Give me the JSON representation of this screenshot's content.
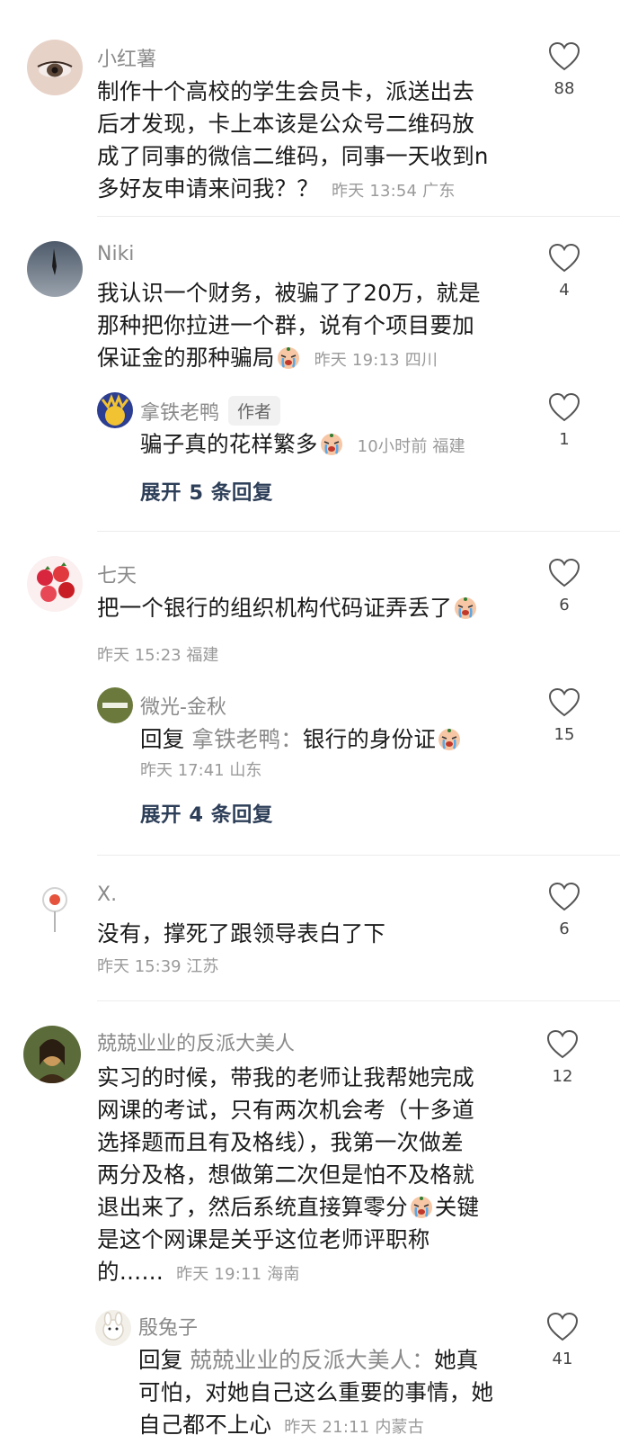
{
  "comments": [
    {
      "user": "小红薯",
      "lines": [
        "制作十个高校的学生会员卡，派送出去",
        "后才发现，卡上本该是公众号二维码放",
        "成了同事的微信二维码，同事一天收到n",
        "多好友申请来问我？？"
      ],
      "time": "昨天 13:54 广东",
      "likes": "88"
    },
    {
      "user": "Niki",
      "lines": [
        "我认识一个财务，被骗了了20万，就是",
        "那种把你拉进一个群，说有个项目要加",
        "保证金的那种骗局"
      ],
      "time": "昨天 19:13 四川",
      "likes": "4",
      "reply": {
        "user": "拿铁老鸭",
        "tag": "作者",
        "text": "骗子真的花样繁多",
        "time": "10小时前 福建",
        "likes": "1"
      },
      "expand": "展开 5 条回复"
    },
    {
      "user": "七天",
      "lines": [
        "把一个银行的组织机构代码证弄丢了"
      ],
      "time": "昨天 15:23 福建",
      "likes": "6",
      "reply": {
        "user": "微光-金秋",
        "prefix": "回复",
        "to": "拿铁老鸭：",
        "text": "银行的身份证",
        "time": "昨天 17:41 山东",
        "likes": "15"
      },
      "expand": "展开 4 条回复"
    },
    {
      "user": "X.",
      "lines": [
        "没有，撑死了跟领导表白了下"
      ],
      "time": "昨天 15:39 江苏",
      "likes": "6"
    },
    {
      "user": "兢兢业业的反派大美人",
      "lines": [
        "实习的时候，带我的老师让我帮她完成",
        "网课的考试，只有两次机会考（十多道",
        "选择题而且有及格线），我第一次做差",
        "两分及格，想做第二次但是怕不及格就",
        "退出来了，然后系统直接算零分",
        "是这个网课是关乎这位老师评职称",
        "的……"
      ],
      "keyword": "关键",
      "time": "昨天 19:11 海南",
      "likes": "12",
      "reply": {
        "user": "殷兔子",
        "prefix": "回复",
        "to": "兢兢业业的反派大美人：",
        "lines": [
          "她真",
          "可怕，对她自己这么重要的事情，她",
          "自己都不上心"
        ],
        "time": "昨天 21:11 内蒙古",
        "likes": "41"
      }
    }
  ],
  "icons": {
    "like": "heart-outline-icon",
    "emoji": "crying-face-icon"
  },
  "colors": {
    "expand": "#2d3e58",
    "meta": "#9a9a9a",
    "username": "#8a8a8a"
  }
}
